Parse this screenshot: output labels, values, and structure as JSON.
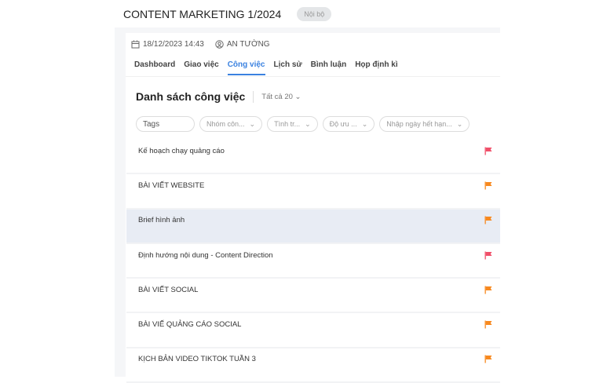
{
  "header": {
    "title": "CONTENT MARKETING 1/2024",
    "badge": "Nội bộ"
  },
  "meta": {
    "date": "18/12/2023 14:43",
    "owner": "AN TƯỜNG"
  },
  "tabs": [
    {
      "label": "Dashboard"
    },
    {
      "label": "Giao việc"
    },
    {
      "label": "Công việc",
      "active": true
    },
    {
      "label": "Lịch sử"
    },
    {
      "label": "Bình luận"
    },
    {
      "label": "Họp định kì"
    }
  ],
  "list": {
    "title": "Danh sách công việc",
    "count_label": "Tất cả 20"
  },
  "filters": {
    "tags": "Tags",
    "group": "Nhóm côn...",
    "status": "Tình tr...",
    "priority": "Độ ưu ...",
    "due": "Nhập ngày hết hạn..."
  },
  "colors": {
    "red": "#f0506a",
    "orange": "#f7891f",
    "accent": "#3b82e0"
  },
  "tasks": [
    {
      "name": "Kế hoạch chạy quảng cáo",
      "flag": "red"
    },
    {
      "name": "BÀI VIẾT WEBSITE",
      "flag": "orange"
    },
    {
      "name": "Brief hình ảnh",
      "flag": "orange",
      "highlighted": true
    },
    {
      "name": "Định hướng nội dung - Content Direction",
      "flag": "red"
    },
    {
      "name": "BÀI VIẾT SOCIAL",
      "flag": "orange"
    },
    {
      "name": "BÀI VIẾ QUẢNG CÁO SOCIAL",
      "flag": "orange"
    },
    {
      "name": "KỊCH BẢN VIDEO TIKTOK TUẦN 3",
      "flag": "orange"
    }
  ]
}
